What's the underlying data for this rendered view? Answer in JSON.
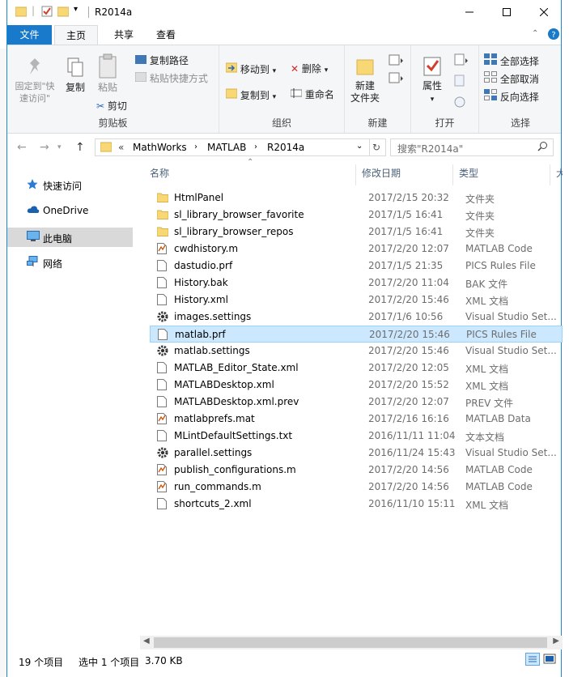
{
  "window": {
    "title": "R2014a"
  },
  "ribbon_tabs": [
    "文件",
    "主页",
    "共享",
    "查看"
  ],
  "ribbon": {
    "clipboard": {
      "label": "剪贴板",
      "pin": "固定到\"快速访问\"",
      "copy": "复制",
      "paste": "粘贴",
      "cut": "剪切",
      "copy_path": "复制路径",
      "paste_shortcut": "粘贴快捷方式"
    },
    "organize": {
      "label": "组织",
      "move_to": "移动到",
      "copy_to": "复制到",
      "delete": "删除",
      "rename": "重命名"
    },
    "new": {
      "label": "新建",
      "new_folder": "新建\n文件夹"
    },
    "open": {
      "label": "打开",
      "properties": "属性"
    },
    "select": {
      "label": "选择",
      "select_all": "全部选择",
      "select_none": "全部取消",
      "invert": "反向选择"
    }
  },
  "address": {
    "prefix": "«",
    "crumbs": [
      "MathWorks",
      "MATLAB",
      "R2014a"
    ],
    "search_placeholder": "搜索\"R2014a\""
  },
  "nav_items": [
    {
      "label": "快速访问",
      "icon": "star-icon"
    },
    {
      "label": "OneDrive",
      "icon": "cloud-icon"
    },
    {
      "label": "此电脑",
      "icon": "computer-icon"
    },
    {
      "label": "网络",
      "icon": "network-icon"
    }
  ],
  "columns": {
    "name": "名称",
    "date": "修改日期",
    "type": "类型",
    "size": "大"
  },
  "files": [
    {
      "name": "HtmlPanel",
      "date": "2017/2/15 20:32",
      "type": "文件夹",
      "kind": "folder"
    },
    {
      "name": "sl_library_browser_favorite",
      "date": "2017/1/5 16:41",
      "type": "文件夹",
      "kind": "folder"
    },
    {
      "name": "sl_library_browser_repos",
      "date": "2017/1/5 16:41",
      "type": "文件夹",
      "kind": "folder"
    },
    {
      "name": "cwdhistory.m",
      "date": "2017/2/20 12:07",
      "type": "MATLAB Code",
      "kind": "matlab"
    },
    {
      "name": "dastudio.prf",
      "date": "2017/1/5 21:35",
      "type": "PICS Rules File",
      "kind": "file"
    },
    {
      "name": "History.bak",
      "date": "2017/2/20 11:04",
      "type": "BAK 文件",
      "kind": "file"
    },
    {
      "name": "History.xml",
      "date": "2017/2/20 15:46",
      "type": "XML 文档",
      "kind": "file"
    },
    {
      "name": "images.settings",
      "date": "2017/1/6 10:56",
      "type": "Visual Studio Set...",
      "kind": "settings"
    },
    {
      "name": "matlab.prf",
      "date": "2017/2/20 15:46",
      "type": "PICS Rules File",
      "kind": "file"
    },
    {
      "name": "matlab.settings",
      "date": "2017/2/20 15:46",
      "type": "Visual Studio Set...",
      "kind": "settings"
    },
    {
      "name": "MATLAB_Editor_State.xml",
      "date": "2017/2/20 12:05",
      "type": "XML 文档",
      "kind": "file"
    },
    {
      "name": "MATLABDesktop.xml",
      "date": "2017/2/20 15:52",
      "type": "XML 文档",
      "kind": "file"
    },
    {
      "name": "MATLABDesktop.xml.prev",
      "date": "2017/2/20 12:07",
      "type": "PREV 文件",
      "kind": "file"
    },
    {
      "name": "matlabprefs.mat",
      "date": "2017/2/16 16:16",
      "type": "MATLAB Data",
      "kind": "matlab"
    },
    {
      "name": "MLintDefaultSettings.txt",
      "date": "2016/11/11 11:04",
      "type": "文本文档",
      "kind": "file"
    },
    {
      "name": "parallel.settings",
      "date": "2016/11/24 15:43",
      "type": "Visual Studio Set...",
      "kind": "settings"
    },
    {
      "name": "publish_configurations.m",
      "date": "2017/2/20 14:56",
      "type": "MATLAB Code",
      "kind": "matlab"
    },
    {
      "name": "run_commands.m",
      "date": "2017/2/20 14:56",
      "type": "MATLAB Code",
      "kind": "matlab"
    },
    {
      "name": "shortcuts_2.xml",
      "date": "2016/11/10 15:11",
      "type": "XML 文档",
      "kind": "file"
    }
  ],
  "selected_file": "matlab.prf",
  "status": {
    "count": "19 个项目",
    "selected": "选中 1 个项目",
    "size": "3.70 KB"
  },
  "colors": {
    "accent": "#1979ca",
    "selection": "#cce8ff",
    "folder": "#f8d775"
  }
}
